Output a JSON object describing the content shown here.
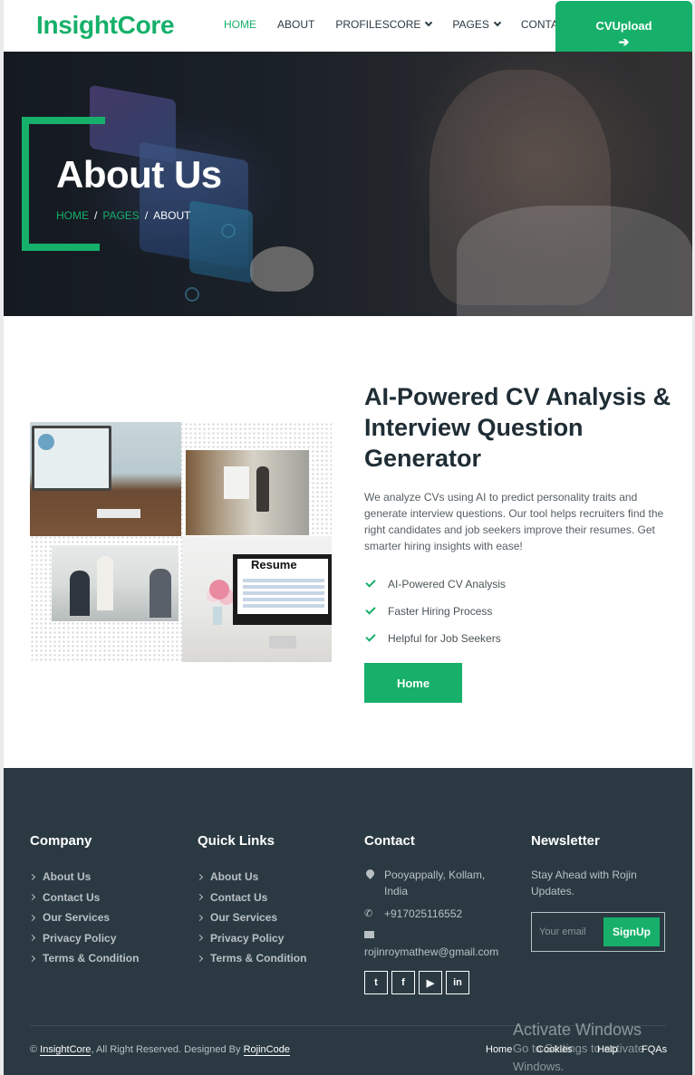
{
  "nav": {
    "brand": "InsightCore",
    "items": [
      {
        "label": "HOME",
        "active": true
      },
      {
        "label": "ABOUT",
        "active": false
      },
      {
        "label": "PROFILESCORE",
        "dropdown": true
      },
      {
        "label": "PAGES",
        "dropdown": true
      },
      {
        "label": "CONTACT",
        "active": false
      }
    ],
    "cta_label": "CVUpload",
    "cta_icon": "arrow-right-icon"
  },
  "hero": {
    "title": "About Us",
    "breadcrumb": [
      "HOME",
      "PAGES",
      "ABOUT"
    ],
    "separator": "/"
  },
  "about": {
    "resume_label": "Resume",
    "title": "AI-Powered CV Analysis & Interview Question Generator",
    "description": "We analyze CVs using AI to predict personality traits and generate interview questions. Our tool helps recruiters find the right candidates and job seekers improve their resumes. Get smarter hiring insights with ease!",
    "features": [
      "AI-Powered CV Analysis",
      "Faster Hiring Process",
      "Helpful for Job Seekers"
    ],
    "button_label": "Home"
  },
  "footer": {
    "company": {
      "heading": "Company",
      "links": [
        "About Us",
        "Contact Us",
        "Our Services",
        "Privacy Policy",
        "Terms & Condition"
      ]
    },
    "quick_links": {
      "heading": "Quick Links",
      "links": [
        "About Us",
        "Contact Us",
        "Our Services",
        "Privacy Policy",
        "Terms & Condition"
      ]
    },
    "contact": {
      "heading": "Contact",
      "address": "Pooyappally, Kollam, India",
      "phone": "+917025116552",
      "email": "rojinroymathew@gmail.com",
      "socials": [
        "twitter-icon",
        "facebook-icon",
        "youtube-icon",
        "linkedin-icon"
      ]
    },
    "newsletter": {
      "heading": "Newsletter",
      "text": "Stay Ahead with Rojin Updates.",
      "placeholder": "Your email",
      "button_label": "SignUp"
    },
    "copyright": {
      "prefix": "©",
      "brand": "InsightCore",
      "middle": ", All Right Reserved. Designed By",
      "designer": "RojinCode"
    },
    "bottom_links": [
      "Home",
      "Cookies",
      "Help",
      "FQAs"
    ]
  },
  "watermark": {
    "line1": "Activate Windows",
    "line2": "Go to Settings to activate Windows."
  },
  "colors": {
    "accent": "#16b06a",
    "footer_bg": "#2b3a42"
  }
}
